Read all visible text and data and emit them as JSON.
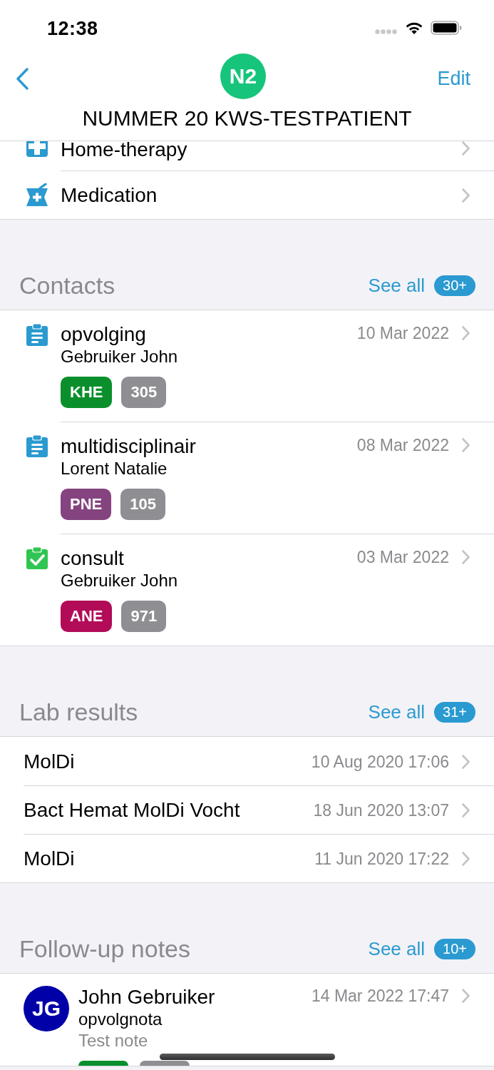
{
  "status_bar": {
    "time": "12:38"
  },
  "nav": {
    "avatar": "N2",
    "title": "NUMMER 20 KWS-TESTPATIENT",
    "action": "Edit"
  },
  "menu_items": [
    {
      "kind": "therapy",
      "label": "Home-therapy"
    },
    {
      "kind": "medication",
      "label": "Medication"
    }
  ],
  "contacts": {
    "title": "Contacts",
    "link": "See all",
    "count": "30+",
    "items": [
      {
        "kind": "pending",
        "title": "opvolging",
        "author": "Gebruiker John",
        "date": "10 Mar 2022",
        "tags": [
          {
            "label": "KHE",
            "color": "#0a8f2c"
          },
          {
            "label": "305",
            "color": "#8e8e93"
          }
        ]
      },
      {
        "kind": "pending",
        "title": "multidisciplinair",
        "author": "Lorent Natalie",
        "date": "08 Mar 2022",
        "tags": [
          {
            "label": "PNE",
            "color": "#85437f"
          },
          {
            "label": "105",
            "color": "#8e8e93"
          }
        ]
      },
      {
        "kind": "done",
        "title": "consult",
        "author": "Gebruiker John",
        "date": "03 Mar 2022",
        "tags": [
          {
            "label": "ANE",
            "color": "#b20b58"
          },
          {
            "label": "971",
            "color": "#8e8e93"
          }
        ]
      }
    ]
  },
  "lab_results": {
    "title": "Lab results",
    "link": "See all",
    "count": "31+",
    "items": [
      {
        "name": "MolDi",
        "date": "10 Aug 2020 17:06"
      },
      {
        "name": "Bact Hemat MolDi Vocht",
        "date": "18 Jun 2020 13:07"
      },
      {
        "name": "MolDi",
        "date": "11 Jun 2020 17:22"
      }
    ]
  },
  "follow_up_notes": {
    "title": "Follow-up notes",
    "link": "See all",
    "count": "10+",
    "items": [
      {
        "avatar": {
          "initials": "JG",
          "color": "#0000a8"
        },
        "author": "John Gebruiker",
        "title": "opvolgnota",
        "text": "Test note",
        "date": "14 Mar 2022 17:47",
        "tags": [
          {
            "color": "#0a8f2c"
          },
          {
            "color": "#8e8e93"
          }
        ]
      }
    ]
  }
}
